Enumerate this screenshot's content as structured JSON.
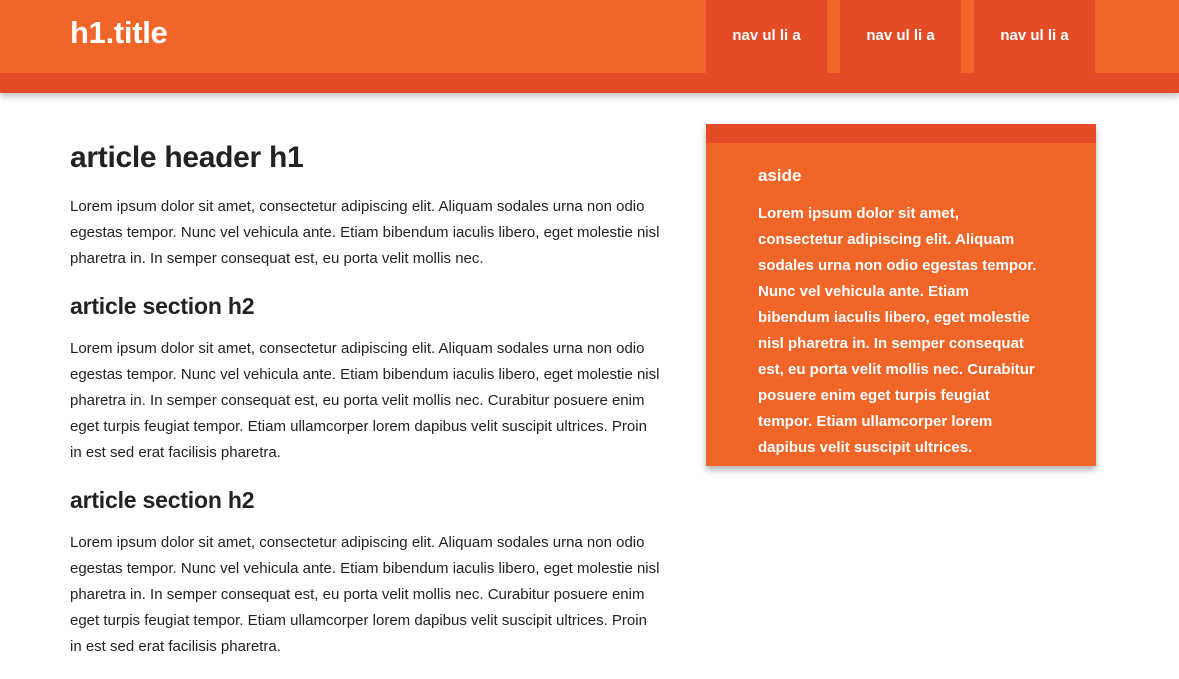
{
  "header": {
    "title": "h1.title",
    "nav": [
      {
        "label": "nav ul li a"
      },
      {
        "label": "nav ul li a"
      },
      {
        "label": "nav ul li a"
      }
    ]
  },
  "article": {
    "heading": "article header h1",
    "intro": "Lorem ipsum dolor sit amet, consectetur adipiscing elit. Aliquam sodales urna non odio egestas tempor. Nunc vel vehicula ante. Etiam bibendum iaculis libero, eget molestie nisl pharetra in. In semper consequat est, eu porta velit mollis nec.",
    "sections": [
      {
        "heading": "article section h2",
        "text": "Lorem ipsum dolor sit amet, consectetur adipiscing elit. Aliquam sodales urna non odio egestas tempor. Nunc vel vehicula ante. Etiam bibendum iaculis libero, eget molestie nisl pharetra in. In semper consequat est, eu porta velit mollis nec. Curabitur posuere enim eget turpis feugiat tempor. Etiam ullamcorper lorem dapibus velit suscipit ultrices. Proin in est sed erat facilisis pharetra."
      },
      {
        "heading": "article section h2",
        "text": "Lorem ipsum dolor sit amet, consectetur adipiscing elit. Aliquam sodales urna non odio egestas tempor. Nunc vel vehicula ante. Etiam bibendum iaculis libero, eget molestie nisl pharetra in. In semper consequat est, eu porta velit mollis nec. Curabitur posuere enim eget turpis feugiat tempor. Etiam ullamcorper lorem dapibus velit suscipit ultrices. Proin in est sed erat facilisis pharetra."
      }
    ]
  },
  "aside": {
    "title": "aside",
    "text": "Lorem ipsum dolor sit amet, consectetur adipiscing elit. Aliquam sodales urna non odio egestas tempor. Nunc vel vehicula ante. Etiam bibendum iaculis libero, eget molestie nisl pharetra in. In semper consequat est, eu porta velit mollis nec. Curabitur posuere enim eget turpis feugiat tempor. Etiam ullamcorper lorem dapibus velit suscipit ultrices."
  },
  "colors": {
    "primary": "#f16529",
    "accent": "#e34c26",
    "text": "#222222",
    "background": "#ffffff"
  }
}
